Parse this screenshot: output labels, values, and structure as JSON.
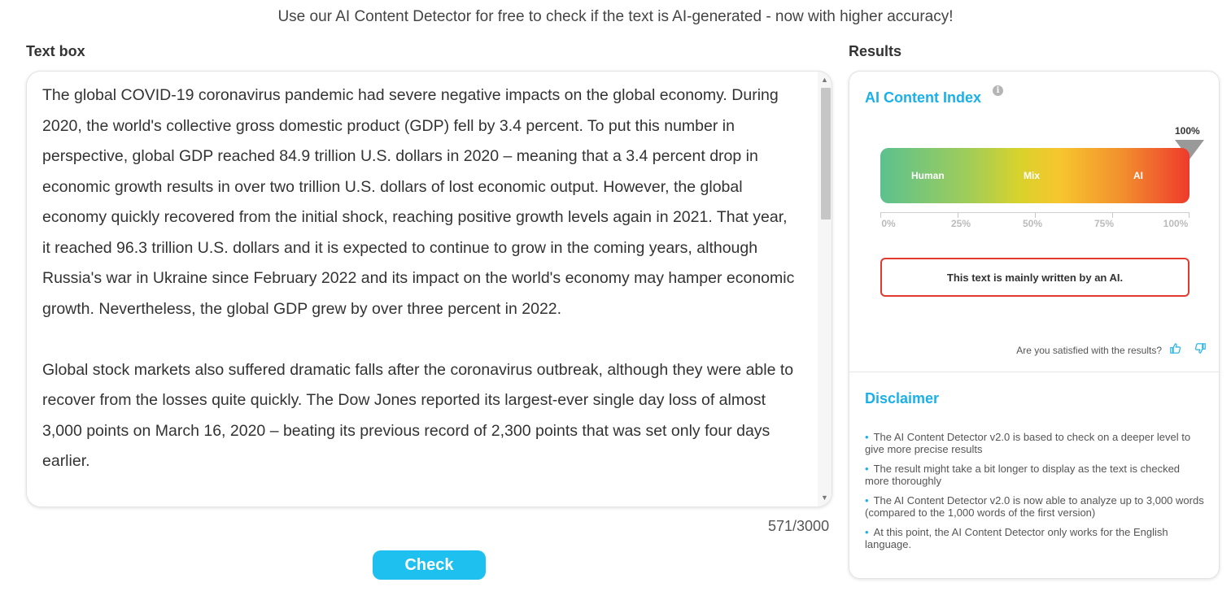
{
  "tagline": "Use our AI Content Detector for free to check if the text is AI-generated - now with higher accuracy!",
  "textbox": {
    "title": "Text box",
    "paragraph1": "The global COVID-19 coronavirus pandemic had severe negative impacts on the global economy. During 2020, the world's collective gross domestic product (GDP) fell by 3.4 percent. To put this number in perspective, global GDP reached 84.9 trillion U.S. dollars in 2020 – meaning that a 3.4 percent drop in economic growth results in over two trillion U.S. dollars of lost economic output. However, the global economy quickly recovered from the initial shock, reaching positive growth levels again in 2021. That year, it reached 96.3 trillion U.S. dollars and it is expected to continue to grow in the coming years, although Russia's war in Ukraine since February 2022 and its impact on the world's economy may hamper economic growth. Nevertheless, the global GDP grew by over three percent in 2022.",
    "paragraph2": "Global stock markets also suffered dramatic falls after the coronavirus outbreak, although they were able to recover from the losses quite quickly. The Dow Jones reported its largest-ever single day loss of almost 3,000 points on March 16, 2020 – beating its previous record of 2,300 points that was set only four days earlier.",
    "counter": "571/3000",
    "check_label": "Check"
  },
  "results": {
    "title": "Results",
    "index_title": "AI Content Index",
    "info_glyph": "i",
    "score_label": "100%",
    "score_fraction": 1.0,
    "gauge_labels": {
      "human": "Human",
      "mix": "Mix",
      "ai": "AI"
    },
    "ticks": [
      "0%",
      "25%",
      "50%",
      "75%",
      "100%"
    ],
    "verdict": "This text is mainly written by an AI.",
    "verdict_color": "#e23a2e",
    "feedback_question": "Are you satisfied with the results?",
    "thumbs_up_icon": "thumbs-up-icon",
    "thumbs_down_icon": "thumbs-down-icon"
  },
  "disclaimer": {
    "title": "Disclaimer",
    "items": [
      "The AI Content Detector v2.0 is based to check on a deeper level to give more precise results",
      "The result might take a bit longer to display as the text is checked more thoroughly",
      "The AI Content Detector v2.0 is now able to analyze up to 3,000 words (compared to the 1,000 words of the first version)",
      "At this point, the AI Content Detector only works for the English language."
    ]
  },
  "colors": {
    "accent": "#1ab0e8",
    "button": "#1ec0f0",
    "human": "#5cc18f",
    "mix": "#f6c62e",
    "ai": "#ee3a2c"
  }
}
